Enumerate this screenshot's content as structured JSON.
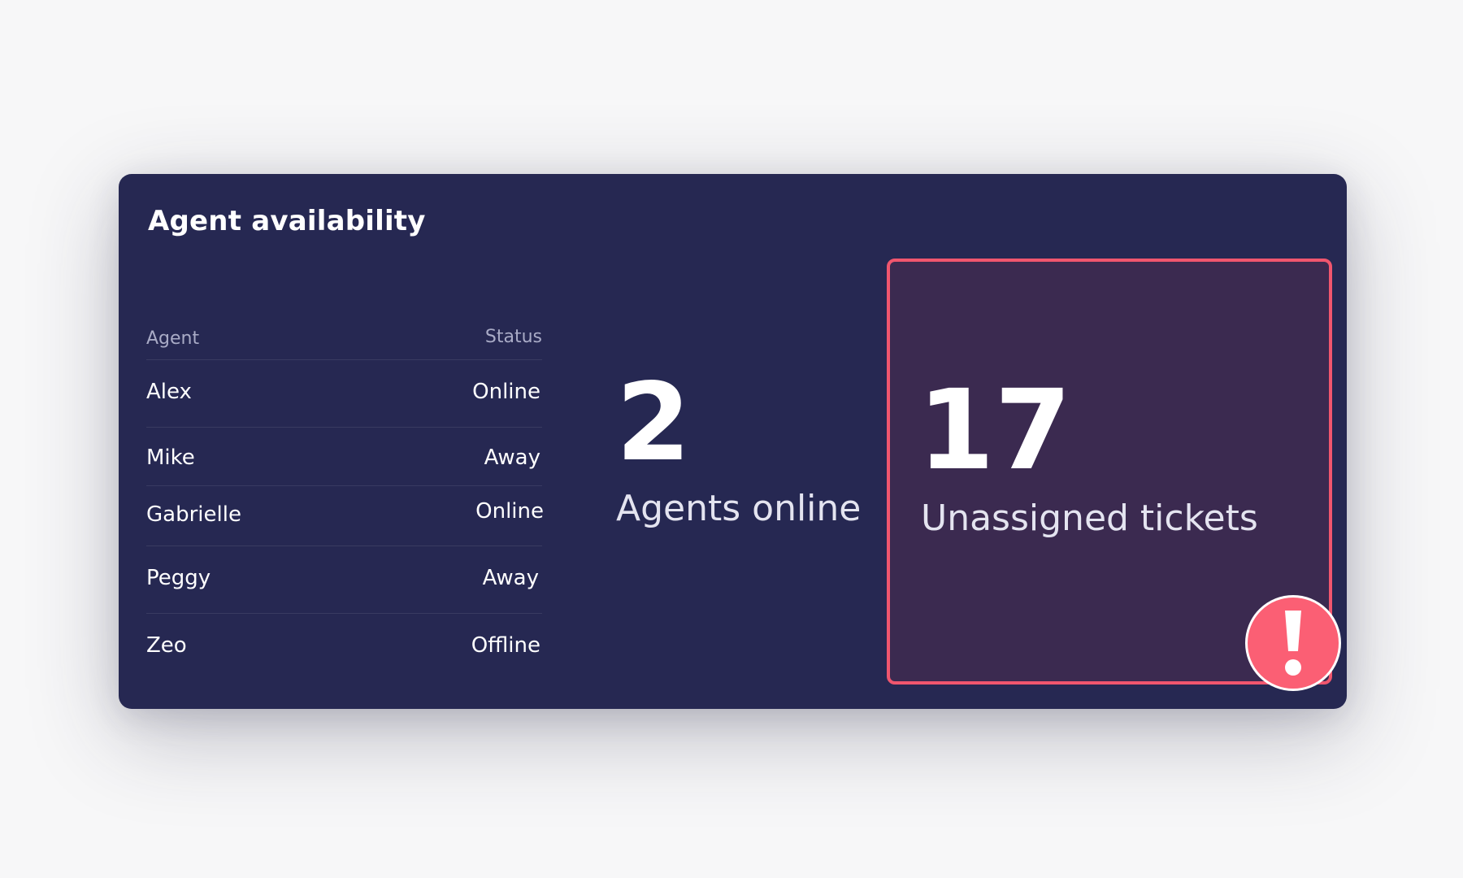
{
  "panel": {
    "title": "Agent availability"
  },
  "table": {
    "headers": {
      "agent": "Agent",
      "status": "Status"
    },
    "rows": [
      {
        "name": "Alex",
        "status": "Online"
      },
      {
        "name": "Mike",
        "status": "Away"
      },
      {
        "name": "Gabrielle",
        "status": "Online"
      },
      {
        "name": "Peggy",
        "status": "Away"
      },
      {
        "name": "Zeo",
        "status": "Offline"
      }
    ]
  },
  "metrics": {
    "agents_online": {
      "value": "2",
      "label": "Agents online"
    },
    "unassigned_tickets": {
      "value": "17",
      "label": "Unassigned tickets"
    }
  },
  "alert": {
    "icon": "exclamation-icon"
  },
  "colors": {
    "panel_bg": "#262852",
    "alert_bg": "#3b2a50",
    "alert_accent": "#f0566e",
    "badge": "#fb5f74"
  }
}
